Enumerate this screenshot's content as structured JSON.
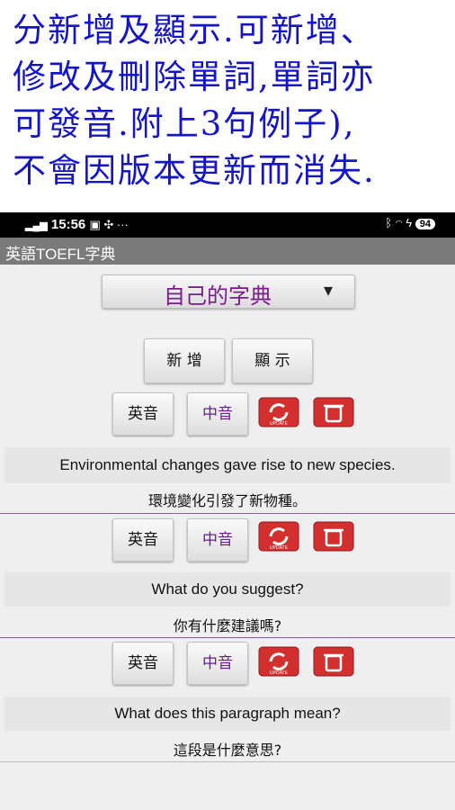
{
  "banner": {
    "lines": [
      "分新增及顯示.可新增、",
      "修改及刪除單詞,單詞亦",
      "可發音.附上3句例子),",
      "不會因版本更新而消失."
    ]
  },
  "status_bar": {
    "time": "15:56",
    "battery": "94"
  },
  "app": {
    "title": "英語TOEFL字典"
  },
  "dictionary_select": {
    "selected": "自己的字典"
  },
  "actions": {
    "add_label": "新 增",
    "show_label": "顯 示"
  },
  "sentence_controls": {
    "english_audio": "英音",
    "chinese_audio": "中音",
    "update_icon_text": "UPDATE"
  },
  "entries": [
    {
      "english": "Environmental changes gave rise to new species.",
      "chinese": "環境變化引發了新物種。"
    },
    {
      "english": "What do you suggest?",
      "chinese": "你有什麼建議嗎?"
    },
    {
      "english": "What does this paragraph mean?",
      "chinese": "這段是什麼意思?"
    }
  ],
  "colors": {
    "banner_text": "#1414c8",
    "accent_purple": "#6a1b9a",
    "icon_red": "#d32f2f"
  }
}
